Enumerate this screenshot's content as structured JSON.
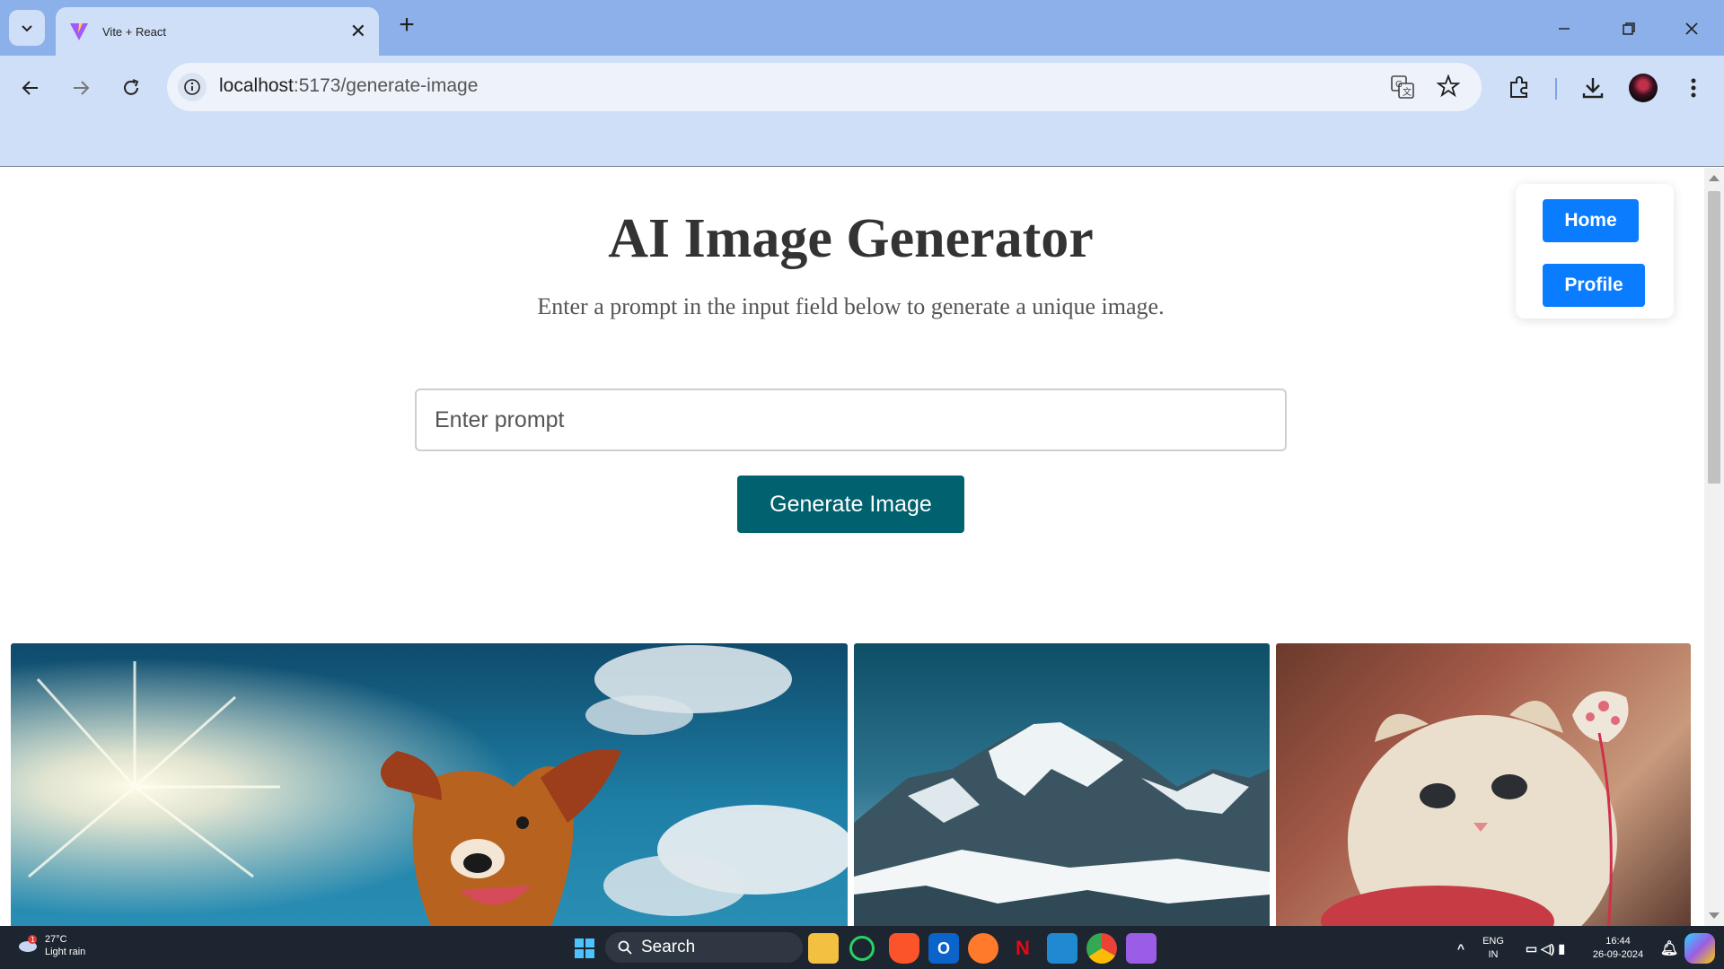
{
  "browser": {
    "tab_title": "Vite + React",
    "url_host": "localhost",
    "url_path": ":5173/generate-image"
  },
  "page": {
    "title": "AI Image Generator",
    "subtitle": "Enter a prompt in the input field below to generate a unique image.",
    "prompt_placeholder": "Enter prompt",
    "generate_label": "Generate Image",
    "nav": {
      "home_label": "Home",
      "profile_label": "Profile"
    },
    "accent_color": "#00616f",
    "nav_color": "#0a7cff"
  },
  "taskbar": {
    "temperature": "27°C",
    "weather": "Light rain",
    "search_label": "Search",
    "lang_line1": "ENG",
    "lang_line2": "IN",
    "time": "16:44",
    "date": "26-09-2024"
  }
}
